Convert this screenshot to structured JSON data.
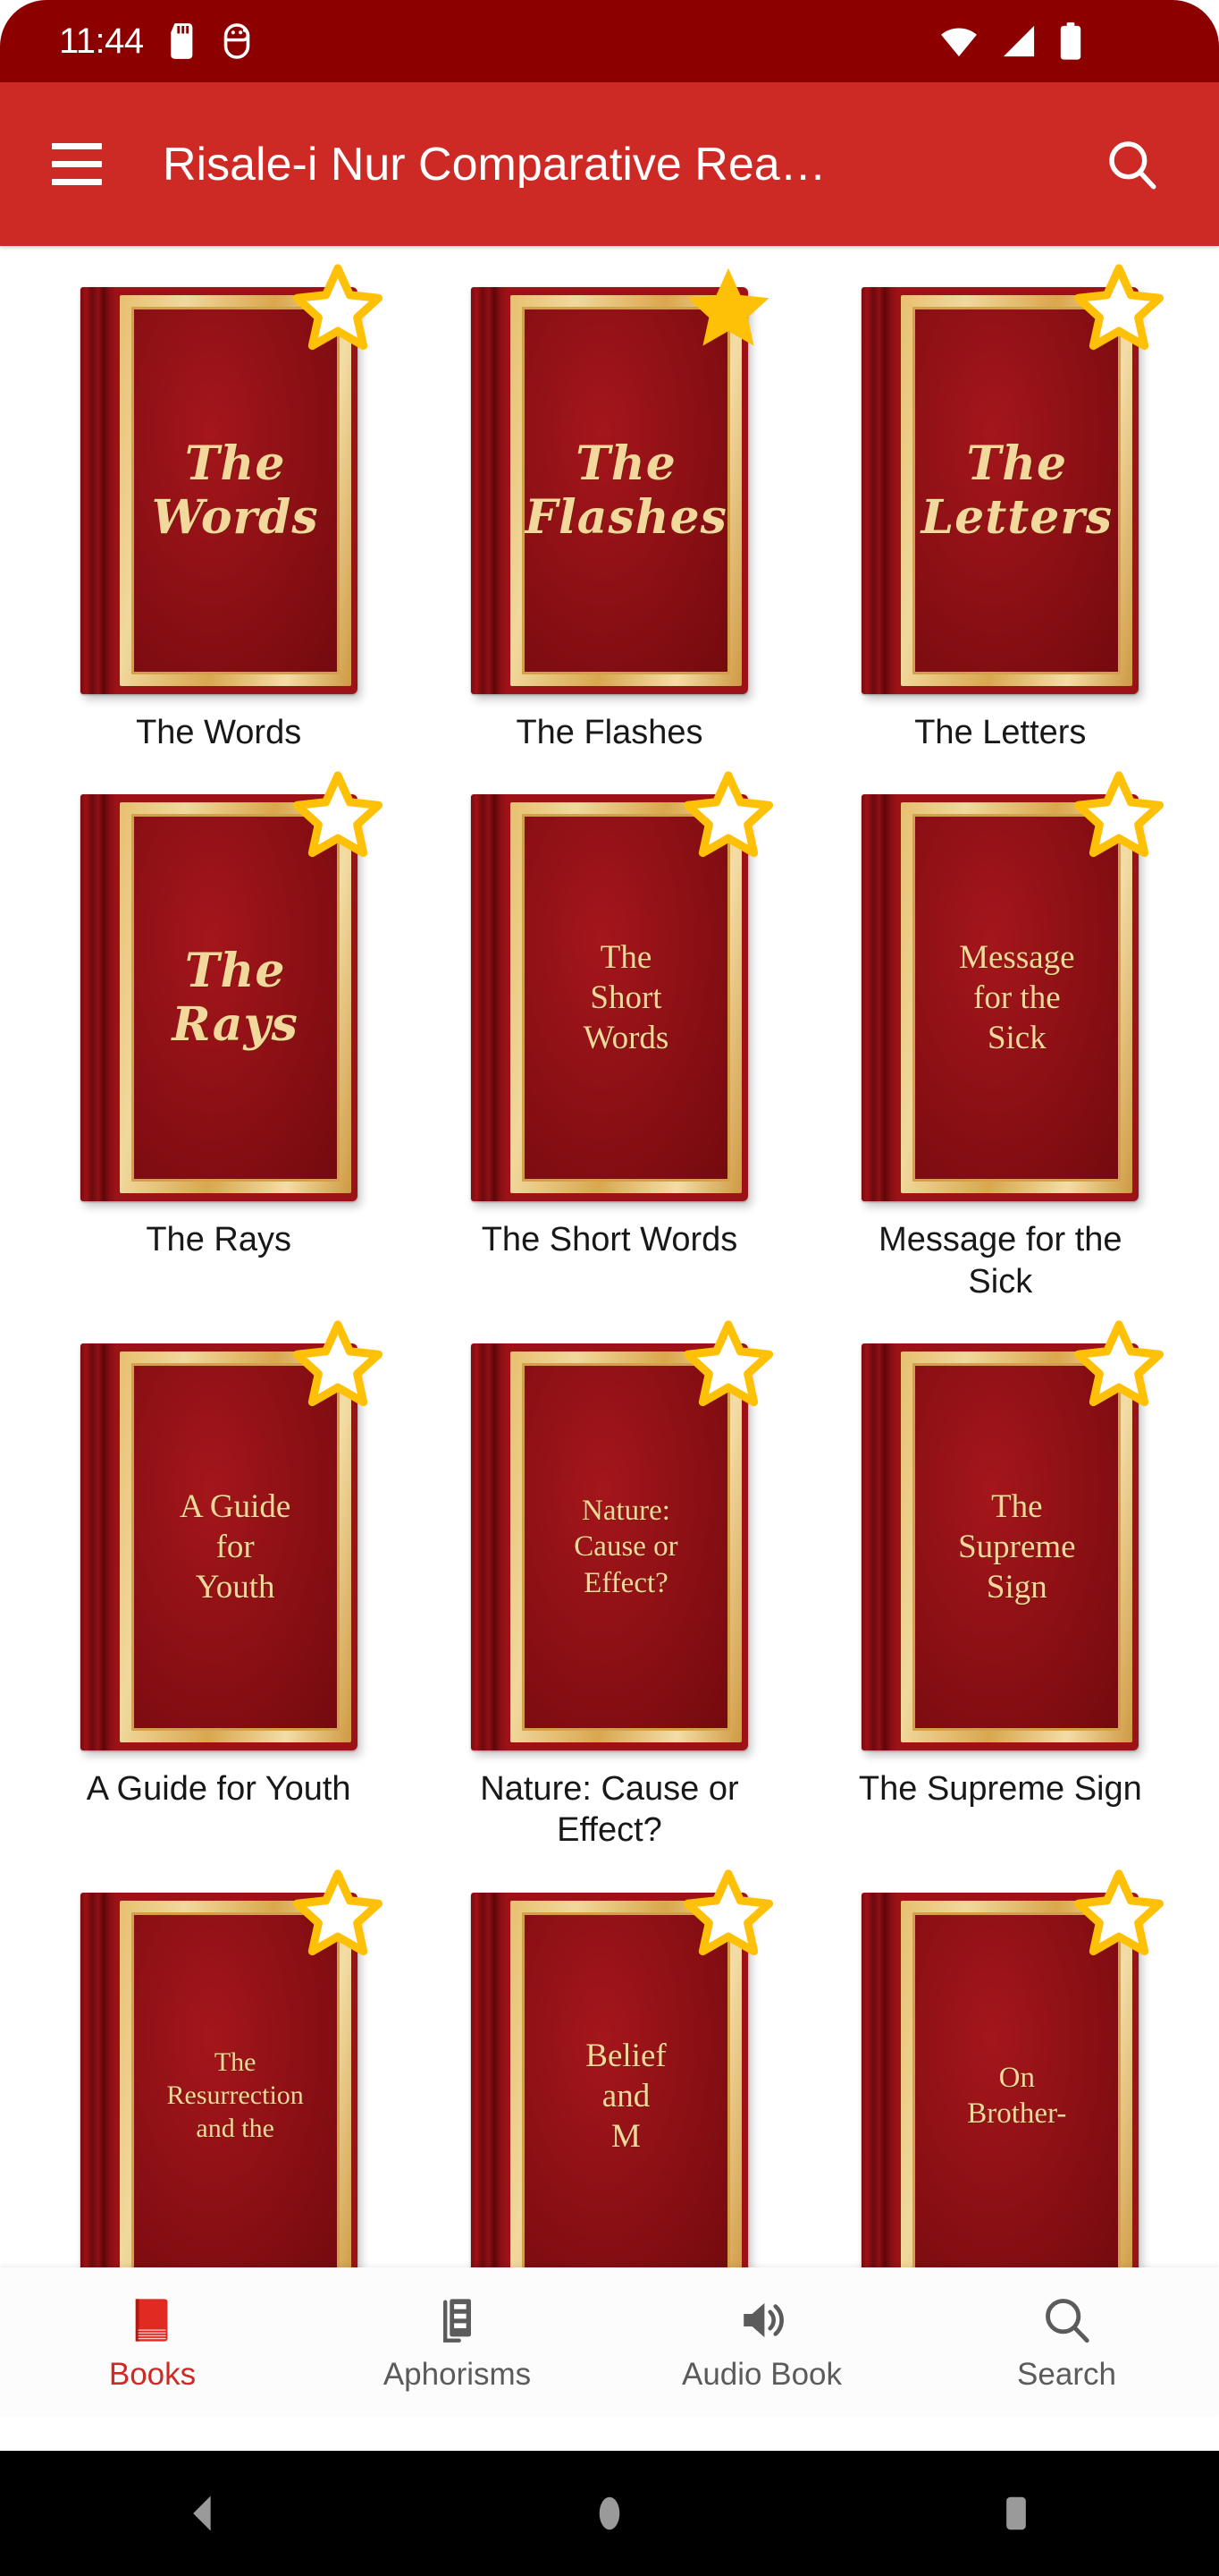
{
  "status_bar": {
    "time": "11:44",
    "left_icons": [
      "sd-card-icon",
      "android-debug-icon"
    ],
    "right_icons": [
      "wifi-icon",
      "cellular-signal-icon",
      "battery-icon"
    ],
    "background_color": "#8C0000"
  },
  "app_bar": {
    "menu_icon": "hamburger-menu-icon",
    "title": "Risale-i Nur Comparative Rea…",
    "search_icon": "search-icon",
    "background_color": "#CE2A25",
    "title_color": "#FFFFFF"
  },
  "theme": {
    "accent": "#CE2A25",
    "status_bar": "#8C0000",
    "cover_red": "#9C1217",
    "cover_gold": "#E7C070",
    "cover_text_gold": "#F2D89C",
    "star_gold": "#FFC107",
    "nav_inactive": "#5B5B5B",
    "page_background": "#FFFFFF"
  },
  "library": {
    "books": [
      {
        "title": "The Words",
        "cover_text": "The\nWords",
        "style": "gothic",
        "favorite": false,
        "star": "star-outline-icon"
      },
      {
        "title": "The Flashes",
        "cover_text": "The\nFlashes",
        "style": "gothic",
        "favorite": true,
        "star": "star-filled-icon"
      },
      {
        "title": "The Letters",
        "cover_text": "The\nLetters",
        "style": "gothic",
        "favorite": false,
        "star": "star-outline-icon"
      },
      {
        "title": "The Rays",
        "cover_text": "The\nRays",
        "style": "gothic",
        "favorite": false,
        "star": "star-outline-icon"
      },
      {
        "title": "The Short Words",
        "cover_text": "The\nShort\nWords",
        "style": "serif",
        "favorite": false,
        "star": "star-outline-icon"
      },
      {
        "title": "Message for the Sick",
        "cover_text": "Message\nfor the\nSick",
        "style": "serif",
        "favorite": false,
        "star": "star-outline-icon"
      },
      {
        "title": "A Guide for Youth",
        "cover_text": "A Guide\nfor\nYouth",
        "style": "serif",
        "favorite": false,
        "star": "star-outline-icon"
      },
      {
        "title": "Nature: Cause or Effect?",
        "cover_text": "Nature:\nCause or\nEffect?",
        "style": "serif",
        "favorite": false,
        "star": "star-outline-icon"
      },
      {
        "title": "The Supreme Sign",
        "cover_text": "The\nSupreme\nSign",
        "style": "serif",
        "favorite": false,
        "star": "star-outline-icon"
      },
      {
        "title": "The Resurrection and the Hereafter",
        "cover_text": "The\nResurrection\nand the",
        "style": "serif",
        "favorite": false,
        "star": "star-outline-icon"
      },
      {
        "title": "Belief and Man",
        "cover_text": "Belief\nand\nM",
        "style": "serif",
        "favorite": false,
        "star": "star-outline-icon"
      },
      {
        "title": "On Brotherhood",
        "cover_text": "On\nBrother-",
        "style": "serif",
        "favorite": false,
        "star": "star-outline-icon"
      }
    ]
  },
  "bottom_nav": {
    "items": [
      {
        "label": "Books",
        "icon": "book-icon",
        "active": true
      },
      {
        "label": "Aphorisms",
        "icon": "list-icon",
        "active": false
      },
      {
        "label": "Audio Book",
        "icon": "speaker-icon",
        "active": false
      },
      {
        "label": "Search",
        "icon": "search-icon",
        "active": false
      }
    ]
  },
  "system_nav": {
    "buttons": [
      {
        "name": "back-button",
        "icon": "triangle-back-icon"
      },
      {
        "name": "home-button",
        "icon": "circle-home-icon"
      },
      {
        "name": "recents-button",
        "icon": "square-recents-icon"
      }
    ]
  }
}
